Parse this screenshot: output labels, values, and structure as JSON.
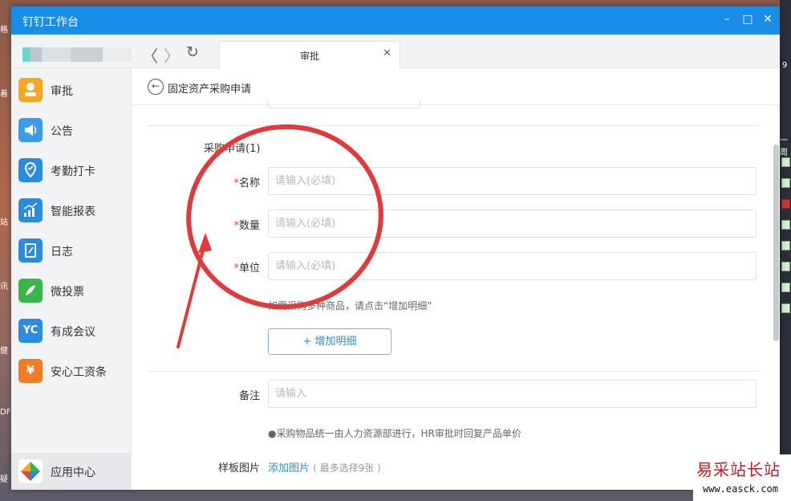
{
  "window": {
    "title": "钉钉工作台",
    "minimize": "–",
    "maximize": "□",
    "close": "✕"
  },
  "toolbar": {
    "back": "〈",
    "forward": "〉",
    "refresh": "↻",
    "tab_label": "审批",
    "tab_close": "✕"
  },
  "sidebar": {
    "items": [
      {
        "label": "审批",
        "icon": "approval-icon",
        "color": "#f5a623"
      },
      {
        "label": "公告",
        "icon": "announcement-icon",
        "color": "#3a9be8"
      },
      {
        "label": "考勤打卡",
        "icon": "checkin-icon",
        "color": "#2a8ce0"
      },
      {
        "label": "智能报表",
        "icon": "report-icon",
        "color": "#2a8ce0"
      },
      {
        "label": "日志",
        "icon": "log-icon",
        "color": "#2a8ce0"
      },
      {
        "label": "微投票",
        "icon": "vote-icon",
        "color": "#3bb54a"
      },
      {
        "label": "有成会议",
        "icon": "meeting-icon",
        "color": "#2a8ce0"
      },
      {
        "label": "安心工资条",
        "icon": "payslip-icon",
        "color": "#f07c26"
      }
    ],
    "app_center": "应用中心"
  },
  "page": {
    "title": "固定资产采购申请",
    "section_title": "采购申请(1)",
    "fields": [
      {
        "label": "名称",
        "placeholder": "请输入(必填)"
      },
      {
        "label": "数量",
        "placeholder": "请输入(必填)"
      },
      {
        "label": "单位",
        "placeholder": "请输入(必填)"
      }
    ],
    "multi_hint": "如需采购多种商品，请点击“增加明细”",
    "add_detail": "增加明细",
    "remark_label": "备注",
    "remark_placeholder": "请输入",
    "remark_hint": "●采购物品统一由人力资源部进行，HR审批时回复产品单价",
    "sample_label": "样板图片",
    "add_image": "添加图片",
    "image_limit": "( 最多选择9张 )"
  },
  "desktop": {
    "left_chars": [
      "格",
      "着",
      "站",
      "讯",
      "健",
      "DF",
      "疑"
    ],
    "right_chars": [
      "9",
      "一周"
    ]
  },
  "watermark": {
    "title": "易采站长站",
    "url": "www.easck.com"
  },
  "colors": {
    "titlebar": "#1a8de8",
    "accent": "#2a8ce0",
    "required": "#e64340",
    "annotation": "#e03a3a"
  }
}
